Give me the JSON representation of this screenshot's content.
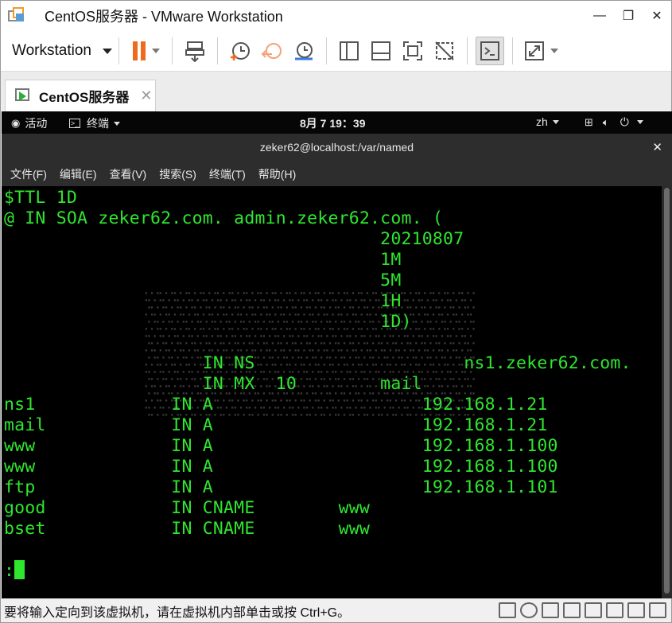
{
  "window": {
    "title": "CentOS服务器 - VMware Workstation",
    "controls": [
      "—",
      "❐",
      "✕"
    ]
  },
  "toolbar": {
    "workstation_label": "Workstation"
  },
  "tab": {
    "label": "CentOS服务器",
    "close": "✕"
  },
  "gnome": {
    "activities": "活动",
    "terminal": "终端",
    "clock": "8月 7  19：39",
    "lang": "zh"
  },
  "terminal": {
    "title": "zeker62@localhost:/var/named",
    "close": "✕",
    "menu": [
      "文件(F)",
      "编辑(E)",
      "查看(V)",
      "搜索(S)",
      "终端(T)",
      "帮助(H)"
    ],
    "lines": [
      "$TTL 1D",
      "@ IN SOA zeker62.com. admin.zeker62.com. (",
      "                                    20210807",
      "                                    1M",
      "                                    5M",
      "                                    1H",
      "                                    1D)",
      "",
      "                   IN NS                    ns1.zeker62.com.",
      "                   IN MX  10        mail",
      "ns1             IN A                    192.168.1.21",
      "mail            IN A                    192.168.1.21",
      "www             IN A                    192.168.1.100",
      "www             IN A                    192.168.1.100",
      "ftp             IN A                    192.168.1.101",
      "good            IN CNAME        www",
      "bset            IN CNAME        www",
      "",
      ":"
    ]
  },
  "statusbar": {
    "text": "要将输入定向到该虚拟机，请在虚拟机内部单击或按 Ctrl+G。"
  },
  "colors": {
    "terminal_text": "#2ee62e",
    "pause_orange": "#f06a1d"
  }
}
